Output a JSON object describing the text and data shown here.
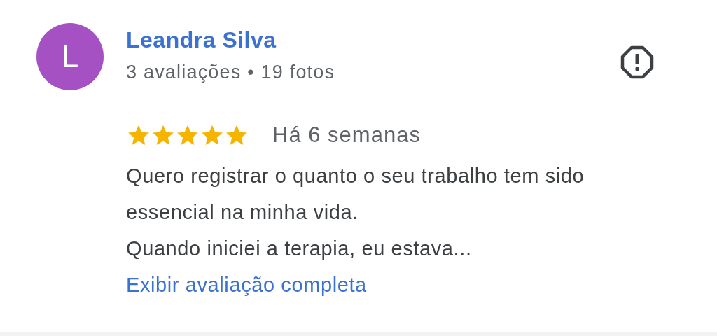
{
  "review": {
    "avatar_letter": "L",
    "author": "Leandra Silva",
    "author_meta": "3 avaliações • 19 fotos",
    "stars": 5,
    "date": "Há 6 semanas",
    "text": "Quero registrar o quanto o seu trabalho tem sido essencial na minha vida.\nQuando iniciei a terapia, eu estava...",
    "more_link": "Exibir avaliação completa"
  }
}
